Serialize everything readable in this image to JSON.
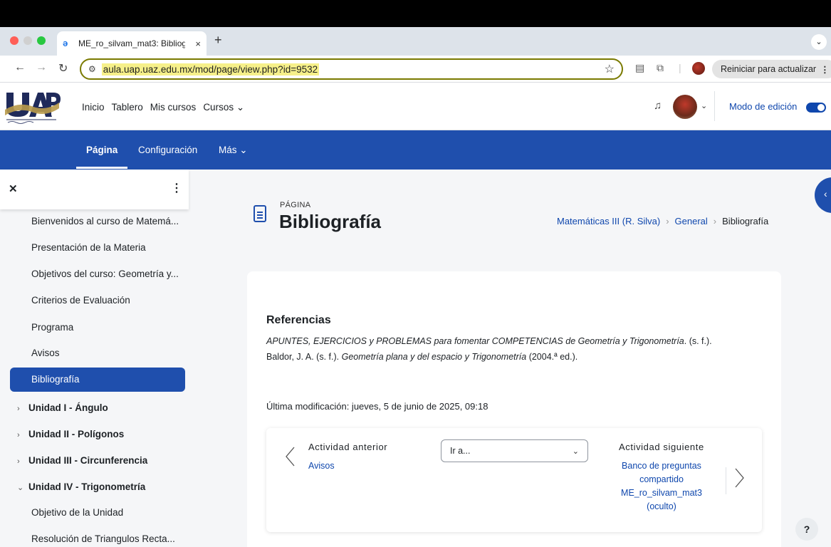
{
  "browser": {
    "tab_title": "ME_ro_silvam_mat3: Bibliografía",
    "tab_close": "×",
    "new_tab": "+",
    "tab_menu": "⌄",
    "url": "aula.uap.uaz.edu.mx/mod/page/view.php?id=9532",
    "relaunch_label": "Reiniciar para actualizar",
    "relaunch_menu": "⋮"
  },
  "header": {
    "nav": [
      "Inicio",
      "Tablero",
      "Mis cursos",
      "Cursos ⌄"
    ],
    "edit_mode_label": "Modo de edición",
    "edit_mode_on": true
  },
  "secondary_nav": {
    "items": [
      "Página",
      "Configuración",
      "Más ⌄"
    ],
    "active": "Página"
  },
  "drawer": {
    "items": [
      "Bienvenidos al curso de Matemá...",
      "Presentación de la Materia",
      "Objetivos del curso: Geometría y...",
      "Criterios de Evaluación",
      "Programa",
      "Avisos",
      "Bibliografía"
    ],
    "active_item": "Bibliografía",
    "sections": [
      {
        "label": "Unidad I - Ángulo",
        "expanded": false
      },
      {
        "label": "Unidad II - Polígonos",
        "expanded": false
      },
      {
        "label": "Unidad III - Circunferencia",
        "expanded": false
      },
      {
        "label": "Unidad IV - Trigonometría",
        "expanded": true
      }
    ],
    "sub_items": [
      "Objetivo de la Unidad",
      "Resolución de Triangulos Recta..."
    ]
  },
  "page": {
    "kind": "PÁGINA",
    "title": "Bibliografía",
    "breadcrumb": [
      "Matemáticas III (R. Silva)",
      "General",
      "Bibliografía"
    ],
    "section_heading": "Referencias",
    "references": [
      {
        "title": "APUNTES, EJERCICIOS y PROBLEMAS para fomentar COMPETENCIAS de Geometría y Trigonometría",
        "rest": ". (s. f.)."
      },
      {
        "author": "Baldor, J. A. (s. f.). ",
        "title": "Geometría plana y del espacio y Trigonometría",
        "rest": " (2004.ª ed.)."
      }
    ],
    "last_modified": "Última modificación: jueves, 5 de junio de 2025, 09:18"
  },
  "activity_nav": {
    "prev_label": "Actividad anterior",
    "prev_link": "Avisos",
    "jump_placeholder": "Ir a...",
    "next_label": "Actividad siguiente",
    "next_link": "Banco de preguntas compartido ME_ro_silvam_mat3 (oculto)"
  },
  "help_label": "?",
  "colors": {
    "brand_blue": "#1f4fad",
    "link": "#0f47ad"
  }
}
